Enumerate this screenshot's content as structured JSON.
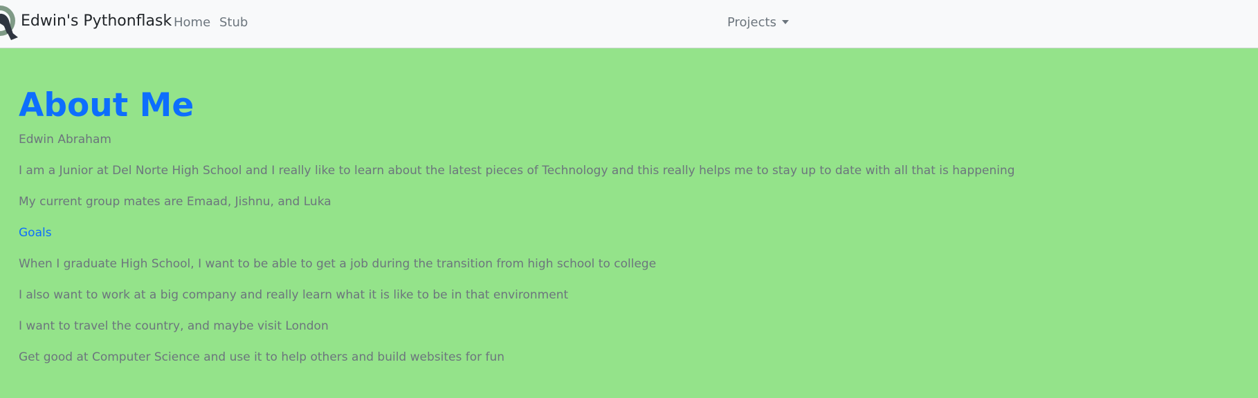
{
  "nav": {
    "brand": "Edwin's Pythonflask",
    "logo_icon": "python-logo-icon",
    "items": [
      {
        "label": "Home"
      },
      {
        "label": "Stub"
      }
    ],
    "dropdown": {
      "label": "Projects"
    }
  },
  "main": {
    "title": "About Me",
    "name": "Edwin Abraham",
    "intro": "I am a Junior at Del Norte High School and I really like to learn about the latest pieces of Technology and this really helps me to stay up to date with all that is happening",
    "groupmates": "My current group mates are Emaad, Jishnu, and Luka",
    "goals_link": "Goals",
    "goals": [
      "When I graduate High School, I want to be able to get a job during the transition from high school to college",
      "I also want to work at a big company and really learn what it is like to be in that environment",
      "I want to travel the country, and maybe visit London",
      "Get good at Computer Science and use it to help others and build websites for fun"
    ]
  },
  "colors": {
    "page_background": "#94e38a",
    "navbar_background": "#f8f9fa",
    "accent": "#0d6efd",
    "muted_text": "#6c757d"
  }
}
